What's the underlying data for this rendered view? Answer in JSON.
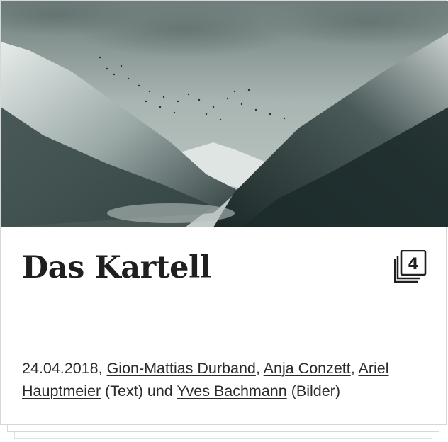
{
  "article": {
    "title": "Das Kartell",
    "image_count": "4",
    "date": "24.04.2018",
    "authors": [
      "Gion-Mattias Durband",
      "Anja Conzett",
      "Ariel Hauptmeier"
    ],
    "author_role": "(Text)",
    "joiner": "und",
    "photographer": "Yves Bachmann",
    "photographer_role": "(Bilder)"
  },
  "icons": {
    "gallery": "image-stack-count-icon"
  }
}
